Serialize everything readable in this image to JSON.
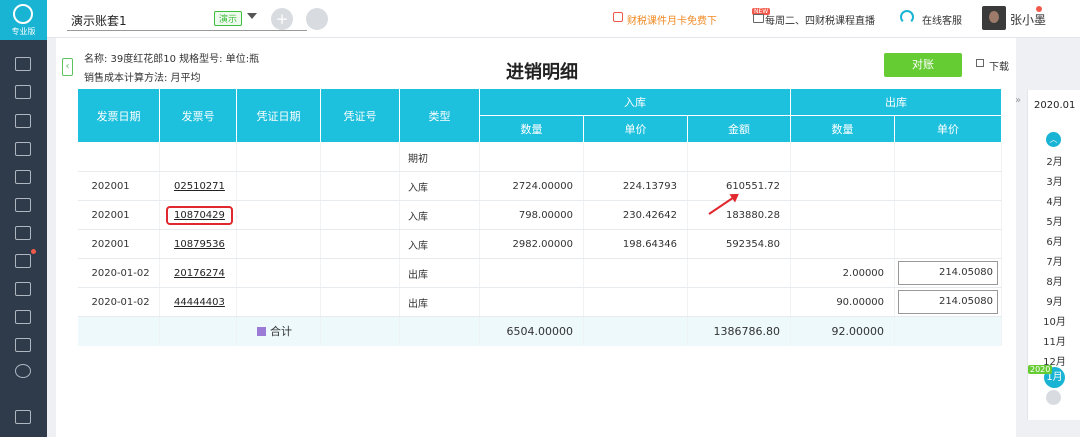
{
  "sidebar": {
    "logo_text": "专业版"
  },
  "topbar": {
    "account": "演示账套1",
    "demo_badge": "演示",
    "add_symbol": "+",
    "promo": "财税课件月卡免费下",
    "new_tag": "NEW",
    "live": "每周二、四财税课程直播",
    "service": "在线客服",
    "user": "张小墨"
  },
  "info": {
    "line1": "名称: 39度红花郎10   规格型号:   单位:瓶",
    "line2": "销售成本计算方法: 月平均"
  },
  "page": {
    "title": "进销明细",
    "reconcile": "对账",
    "download": "下载"
  },
  "table": {
    "headers": {
      "date": "发票日期",
      "invoice": "发票号",
      "voucher_date": "凭证日期",
      "voucher_no": "凭证号",
      "type": "类型",
      "in": "入库",
      "out": "出库",
      "qty": "数量",
      "price": "单价",
      "amount": "金额"
    },
    "rows": [
      {
        "date": "",
        "invoice": "",
        "type": "期初",
        "in_qty": "",
        "in_price": "",
        "in_amount": "",
        "out_qty": "",
        "out_price": ""
      },
      {
        "date": "202001",
        "invoice": "02510271",
        "type": "入库",
        "in_qty": "2724.00000",
        "in_price": "224.13793",
        "in_amount": "610551.72",
        "out_qty": "",
        "out_price": ""
      },
      {
        "date": "202001",
        "invoice": "10870429",
        "type": "入库",
        "in_qty": "798.00000",
        "in_price": "230.42642",
        "in_amount": "183880.28",
        "out_qty": "",
        "out_price": ""
      },
      {
        "date": "202001",
        "invoice": "10879536",
        "type": "入库",
        "in_qty": "2982.00000",
        "in_price": "198.64346",
        "in_amount": "592354.80",
        "out_qty": "",
        "out_price": ""
      },
      {
        "date": "2020-01-02",
        "invoice": "20176274",
        "type": "出库",
        "in_qty": "",
        "in_price": "",
        "in_amount": "",
        "out_qty": "2.00000",
        "out_price": "214.05080"
      },
      {
        "date": "2020-01-02",
        "invoice": "44444403",
        "type": "出库",
        "in_qty": "",
        "in_price": "",
        "in_amount": "",
        "out_qty": "90.00000",
        "out_price": "214.05080"
      }
    ],
    "total": {
      "label": "合计",
      "in_qty": "6504.00000",
      "in_amount": "1386786.80",
      "out_qty": "92.00000"
    }
  },
  "period": {
    "year": "2020.01",
    "months": [
      "2月",
      "3月",
      "4月",
      "5月",
      "6月",
      "7月",
      "8月",
      "9月",
      "10月",
      "11月",
      "12月"
    ],
    "year_badge": "2020",
    "selected": "1月"
  }
}
